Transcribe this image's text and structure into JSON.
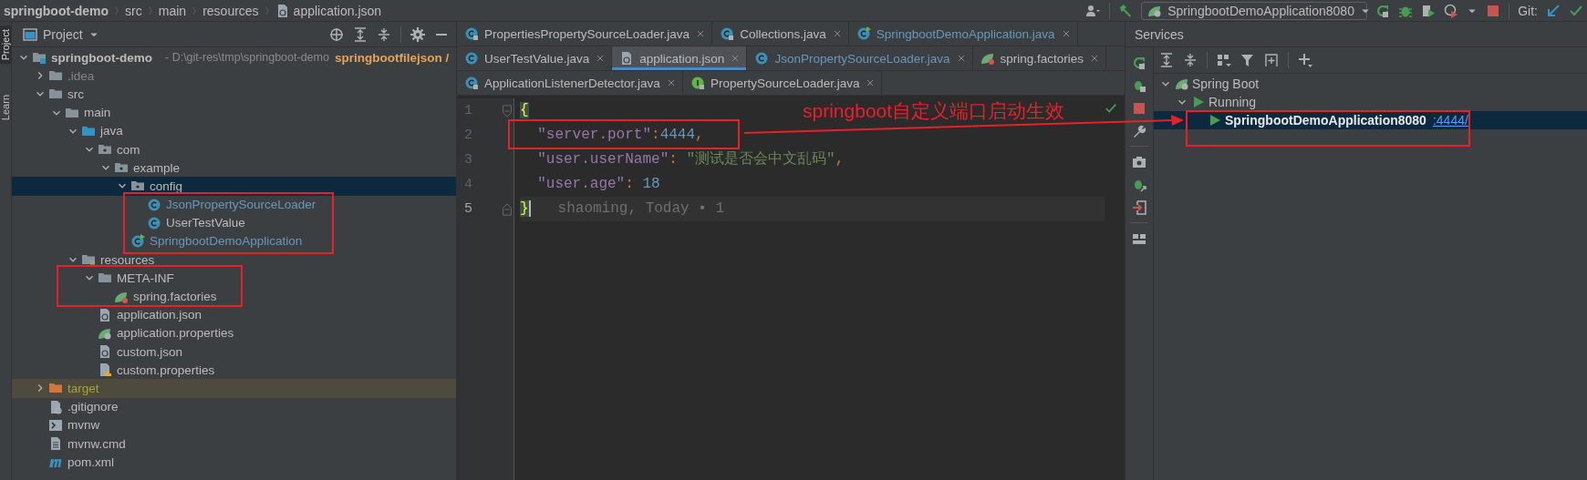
{
  "breadcrumb": [
    {
      "label": "springboot-demo",
      "kind": "project"
    },
    {
      "label": "src",
      "kind": "folder"
    },
    {
      "label": "main",
      "kind": "folder"
    },
    {
      "label": "resources",
      "kind": "folder"
    },
    {
      "label": "application.json",
      "kind": "json-file"
    }
  ],
  "toolbar": {
    "run_config": "SpringbootDemoApplication8080",
    "git_label": "Git:"
  },
  "tool_strip": [
    {
      "label": "Project",
      "selected": true
    },
    {
      "label": "Learn",
      "selected": false
    }
  ],
  "project_panel": {
    "title": "Project",
    "tree": [
      {
        "name": "springboot-demo",
        "kind": "module",
        "location": "- D:\\git-res\\tmp\\springboot-demo",
        "branch": "springbootfilejson /",
        "expanded": true,
        "selected": false,
        "color": "#bbbbbb",
        "children": [
          {
            "name": ".idea",
            "kind": "folder",
            "expanded": false,
            "selected": false,
            "color": "#848484"
          },
          {
            "name": "src",
            "kind": "folder",
            "expanded": true,
            "selected": false,
            "color": "#bbbbbb",
            "children": [
              {
                "name": "main",
                "kind": "folder",
                "expanded": true,
                "selected": false,
                "color": "#bbbbbb",
                "children": [
                  {
                    "name": "java",
                    "kind": "source-folder",
                    "expanded": true,
                    "selected": false,
                    "color": "#bbbbbb",
                    "children": [
                      {
                        "name": "com",
                        "kind": "package",
                        "expanded": true,
                        "selected": false,
                        "color": "#bbbbbb",
                        "children": [
                          {
                            "name": "example",
                            "kind": "package",
                            "expanded": true,
                            "selected": false,
                            "color": "#bbbbbb",
                            "children": [
                              {
                                "name": "config",
                                "kind": "package",
                                "expanded": true,
                                "selected": true,
                                "color": "#bbbbbb",
                                "children": [
                                  {
                                    "name": "JsonPropertySourceLoader",
                                    "kind": "class",
                                    "selected": false,
                                    "color": "#6897bb"
                                  },
                                  {
                                    "name": "UserTestValue",
                                    "kind": "class",
                                    "selected": false,
                                    "color": "#bbbbbb"
                                  }
                                ]
                              },
                              {
                                "name": "SpringbootDemoApplication",
                                "kind": "spring-app",
                                "selected": false,
                                "color": "#6897bb"
                              }
                            ]
                          }
                        ]
                      }
                    ]
                  },
                  {
                    "name": "resources",
                    "kind": "resources-folder",
                    "expanded": true,
                    "selected": false,
                    "color": "#bbbbbb",
                    "children": [
                      {
                        "name": "META-INF",
                        "kind": "folder",
                        "expanded": true,
                        "selected": false,
                        "color": "#bbbbbb",
                        "children": [
                          {
                            "name": "spring.factories",
                            "kind": "spring-file",
                            "selected": false,
                            "color": "#bbbbbb"
                          }
                        ]
                      },
                      {
                        "name": "application.json",
                        "kind": "json-file",
                        "selected": false,
                        "color": "#bbbbbb"
                      },
                      {
                        "name": "application.properties",
                        "kind": "spring-properties",
                        "selected": false,
                        "color": "#bbbbbb"
                      },
                      {
                        "name": "custom.json",
                        "kind": "json-file",
                        "selected": false,
                        "color": "#bbbbbb"
                      },
                      {
                        "name": "custom.properties",
                        "kind": "properties-file",
                        "selected": false,
                        "color": "#bbbbbb"
                      }
                    ]
                  }
                ]
              }
            ]
          },
          {
            "name": "target",
            "kind": "excluded-folder",
            "expanded": false,
            "selected": false,
            "color": "#a4a23e"
          },
          {
            "name": ".gitignore",
            "kind": "gitignore",
            "selected": false,
            "color": "#bbbbbb"
          },
          {
            "name": "mvnw",
            "kind": "shell",
            "selected": false,
            "color": "#bbbbbb"
          },
          {
            "name": "mvnw.cmd",
            "kind": "text-file",
            "selected": false,
            "color": "#bbbbbb"
          },
          {
            "name": "pom.xml",
            "kind": "maven",
            "selected": false,
            "color": "#bbbbbb"
          }
        ]
      }
    ]
  },
  "editor": {
    "tab_rows": [
      [
        {
          "label": "PropertiesPropertySourceLoader.java",
          "kind": "class-locked",
          "selected": false,
          "color": "#bbbbbb"
        },
        {
          "label": "Collections.java",
          "kind": "class-locked",
          "selected": false,
          "color": "#bbbbbb"
        },
        {
          "label": "SpringbootDemoApplication.java",
          "kind": "spring-app",
          "selected": false,
          "color": "#6897bb"
        }
      ],
      [
        {
          "label": "UserTestValue.java",
          "kind": "class",
          "selected": false,
          "color": "#bbbbbb"
        },
        {
          "label": "application.json",
          "kind": "json-file",
          "selected": true,
          "color": "#bbbbbb"
        },
        {
          "label": "JsonPropertySourceLoader.java",
          "kind": "class",
          "selected": false,
          "color": "#6897bb"
        },
        {
          "label": "spring.factories",
          "kind": "spring-file",
          "selected": false,
          "color": "#bbbbbb"
        }
      ],
      [
        {
          "label": "ApplicationListenerDetector.java",
          "kind": "class-locked",
          "selected": false,
          "color": "#bbbbbb"
        },
        {
          "label": "PropertySourceLoader.java",
          "kind": "interface-locked",
          "selected": false,
          "color": "#bbbbbb"
        }
      ]
    ],
    "lines": [
      {
        "number": "1",
        "fold_open": true,
        "fold_close": false,
        "current": false,
        "caret": false,
        "tokens": [
          {
            "text": "{",
            "kind": "brace"
          }
        ]
      },
      {
        "number": "2",
        "fold_open": false,
        "fold_close": false,
        "current": false,
        "caret": false,
        "tokens": [
          {
            "text": "  \"server.port\"",
            "kind": "key"
          },
          {
            "text": ":",
            "kind": "punct"
          },
          {
            "text": "4444",
            "kind": "number"
          },
          {
            "text": ",",
            "kind": "punct"
          }
        ]
      },
      {
        "number": "3",
        "fold_open": false,
        "fold_close": false,
        "current": false,
        "caret": false,
        "tokens": [
          {
            "text": "  \"user.userName\"",
            "kind": "key"
          },
          {
            "text": ":",
            "kind": "punct"
          },
          {
            "text": " \"测试是否会中文乱码\"",
            "kind": "string"
          },
          {
            "text": ",",
            "kind": "punct"
          }
        ]
      },
      {
        "number": "4",
        "fold_open": false,
        "fold_close": false,
        "current": false,
        "caret": false,
        "tokens": [
          {
            "text": "  \"user.age\"",
            "kind": "key"
          },
          {
            "text": ":",
            "kind": "punct"
          },
          {
            "text": " 18",
            "kind": "number"
          }
        ]
      },
      {
        "number": "5",
        "fold_open": false,
        "fold_close": true,
        "current": true,
        "caret": true,
        "tokens": [
          {
            "text": "}",
            "kind": "brace"
          },
          {
            "text": "shaoming, Today • 1",
            "kind": "blame"
          }
        ]
      }
    ]
  },
  "annotation": {
    "text": "springboot自定义端口启动生效"
  },
  "services": {
    "title": "Services",
    "tree": [
      {
        "label": "Spring Boot",
        "kind": "spring",
        "expanded": true,
        "selected": false,
        "children": [
          {
            "label": "Running",
            "kind": "running",
            "expanded": true,
            "selected": false,
            "children": [
              {
                "label": "SpringbootDemoApplication8080",
                "kind": "app",
                "selected": true,
                "link": ":4444/"
              }
            ]
          }
        ]
      }
    ]
  }
}
